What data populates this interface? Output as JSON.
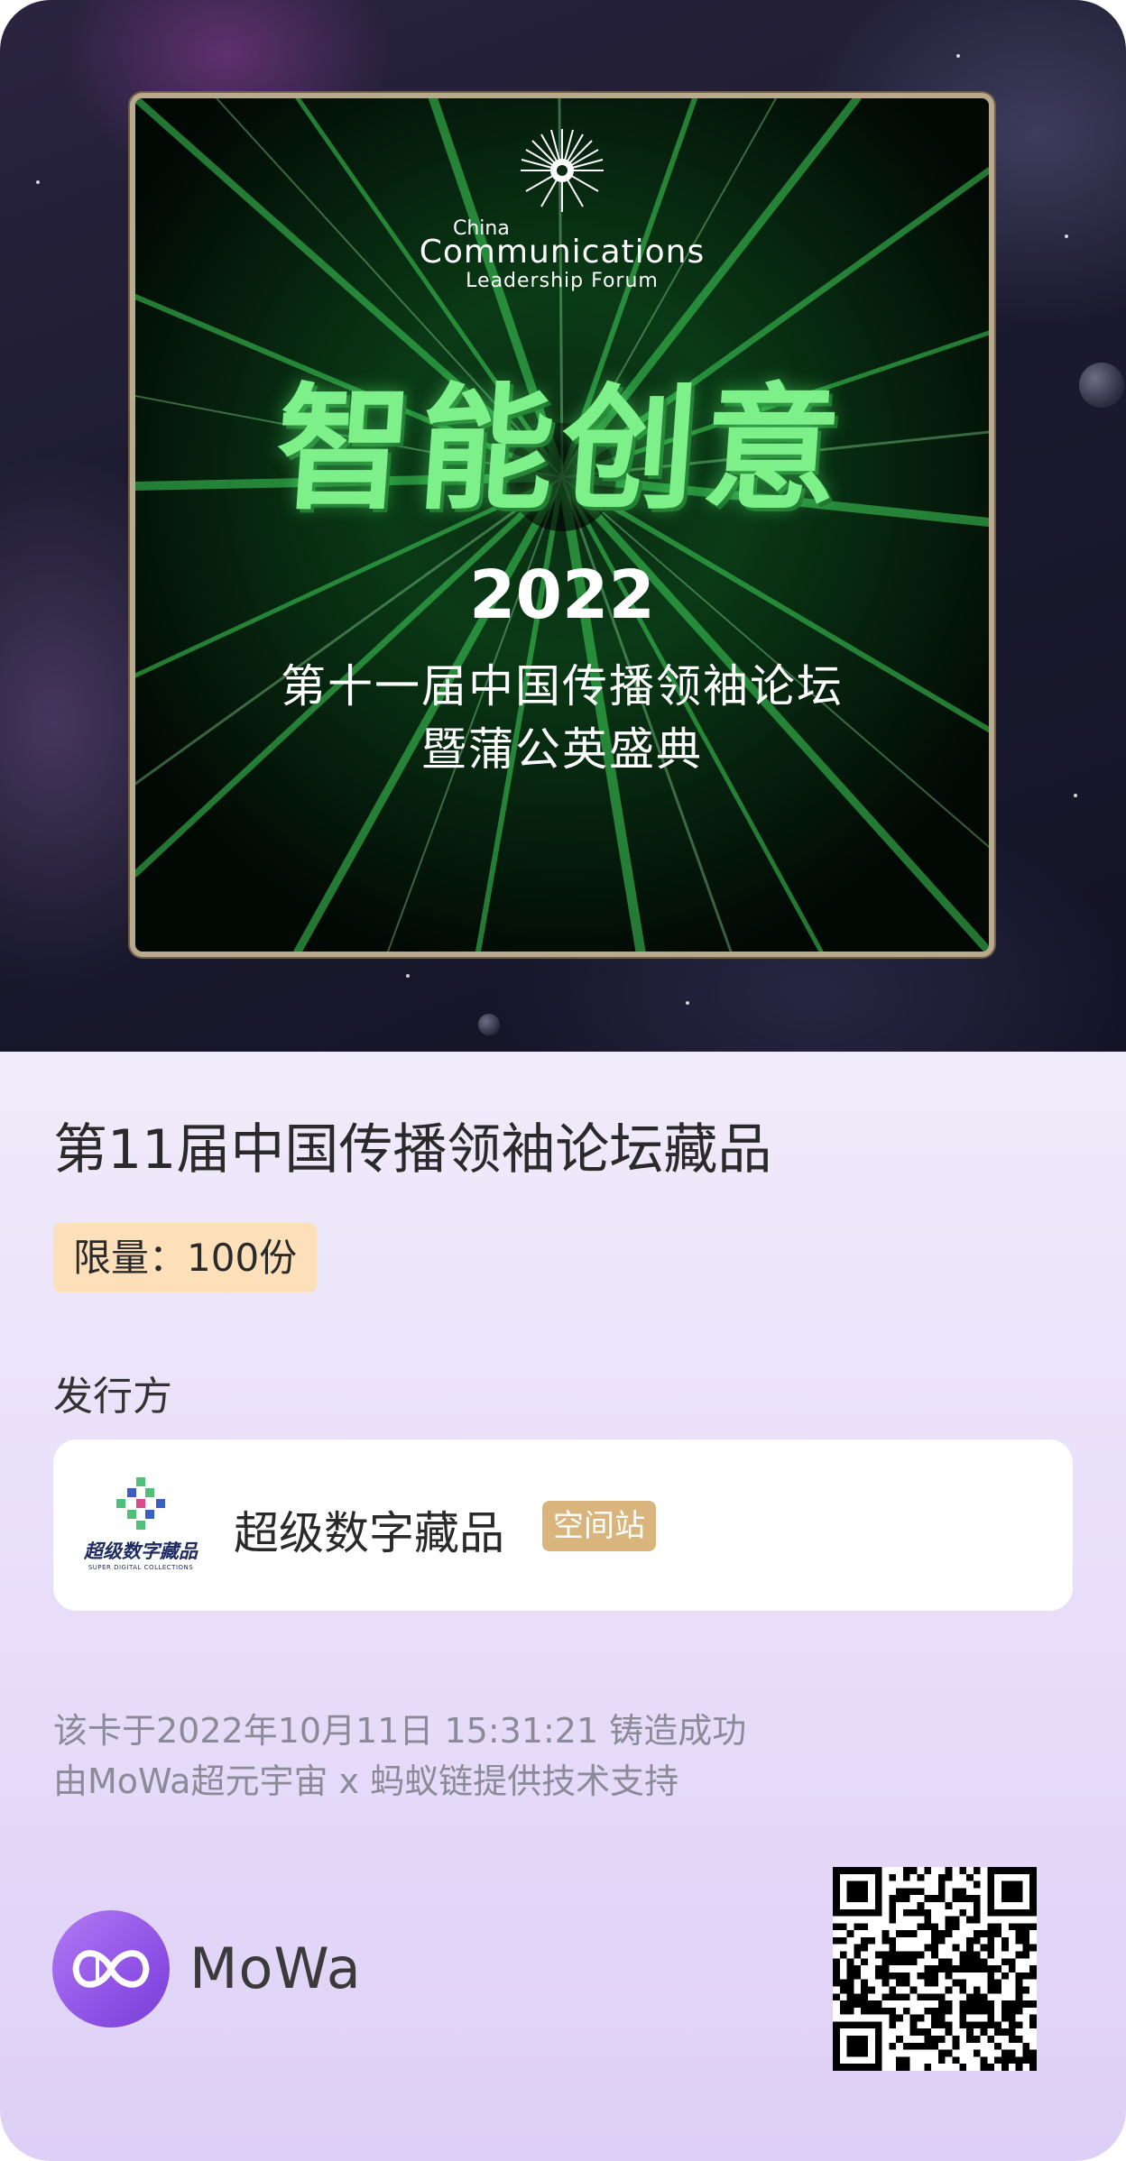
{
  "poster": {
    "logo_line1": "China",
    "logo_line2": "Communications",
    "logo_line3": "Leadership Forum",
    "big_title": "智能创意",
    "year": "2022",
    "subtitle_line1": "第十一届中国传播领袖论坛",
    "subtitle_line2": "暨蒲公英盛典"
  },
  "collectible": {
    "title": "第11届中国传播领袖论坛藏品",
    "limit": "限量：100份"
  },
  "issuer": {
    "label": "发行方",
    "logo_cn": "超级数字藏品",
    "logo_en": "SUPER DIGITAL COLLECTIONS",
    "name": "超级数字藏品",
    "tag": "空间站"
  },
  "footer": {
    "mint_info": "该卡于2022年10月11日 15:31:21 铸造成功",
    "tech_support": "由MoWa超元宇宙 x 蚂蚁链提供技术支持"
  },
  "brand": {
    "name": "MoWa"
  },
  "colors": {
    "accent_purple": "#8f52e6",
    "limit_badge_bg": "#fde0b9",
    "tag_bg": "#d9b57d",
    "poster_green": "#7ef08a"
  },
  "icons": [
    "mowa-logo-icon",
    "issuer-logo-icon",
    "qr-code-icon",
    "forum-sun-icon"
  ]
}
